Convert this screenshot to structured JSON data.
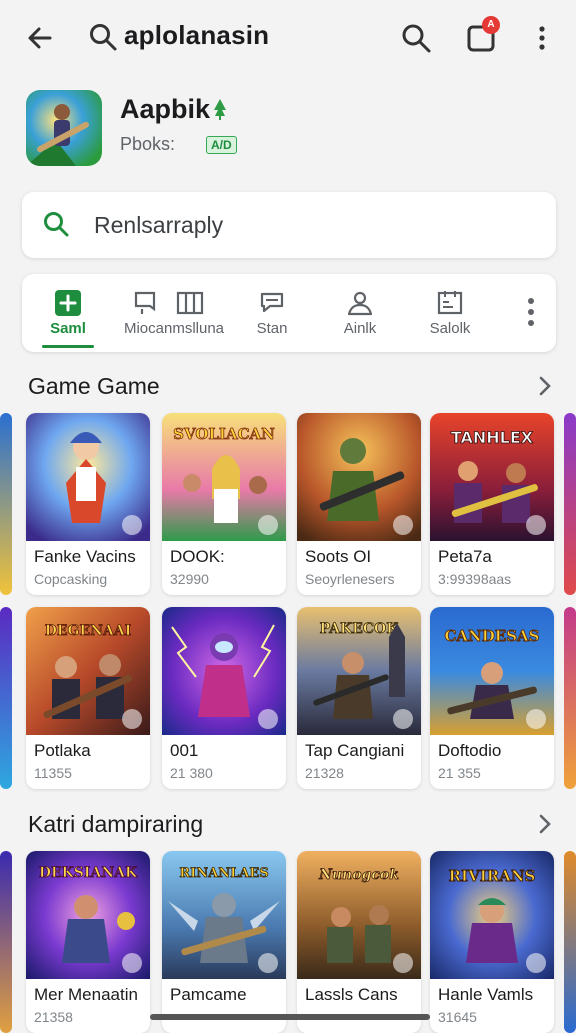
{
  "topbar": {
    "query": "aplolanasin",
    "badge": "A"
  },
  "app": {
    "name": "Aapbik",
    "publisher": "Pboks:",
    "ad_tag": "A/D"
  },
  "search": {
    "placeholder": "Renlsarraply"
  },
  "tabs": [
    {
      "label": "Saml",
      "icon": "plus-icon"
    },
    {
      "label": "Miocanmslluna",
      "icon": "book-columns-icon"
    },
    {
      "label": "Stan",
      "icon": "chat-icon"
    },
    {
      "label": "Ainlk",
      "icon": "person-icon"
    },
    {
      "label": "Salolk",
      "icon": "calendar-icon"
    }
  ],
  "sections": [
    {
      "title": "Game Game",
      "rows": [
        [
          {
            "name": "Fanke Vacins",
            "meta": "Copcasking",
            "art": "ART1"
          },
          {
            "name": "DOOK:",
            "meta": "32990",
            "art": "ART2"
          },
          {
            "name": "Soots OI",
            "meta": "Seoyrlenesers",
            "art": "ART3"
          },
          {
            "name": "Peta7a",
            "meta": "3:99398aas",
            "art": "ART4"
          }
        ],
        [
          {
            "name": "Potlaka",
            "meta": "11355",
            "art": "ART5"
          },
          {
            "name": "001",
            "meta": "21 380",
            "art": "ART6"
          },
          {
            "name": "Tap Cangiani",
            "meta": "21328",
            "art": "ART7"
          },
          {
            "name": "Doftodio",
            "meta": "21 355",
            "art": "ART8"
          }
        ]
      ]
    },
    {
      "title": "Katri dampiraring",
      "rows": [
        [
          {
            "name": "Mer Menaatin",
            "meta": "21358",
            "art": "ART9"
          },
          {
            "name": "Pamcame",
            "meta": "",
            "art": "ART10"
          },
          {
            "name": "Lassls Cans",
            "meta": "",
            "art": "ART11"
          },
          {
            "name": "Hanle Vamls",
            "meta": "31645",
            "art": "ART12"
          }
        ]
      ]
    }
  ],
  "art_text": {
    "ART1": "",
    "ART2": "SVOLIACAN",
    "ART3": "",
    "ART4": "TANHLEX",
    "ART5": "DEGENAAI",
    "ART6": "",
    "ART7": "PAKECOK",
    "ART8": "CANDESAS",
    "ART9": "DEKSIANAK",
    "ART10": "RINANLAES",
    "ART11": "Nunogcok",
    "ART12": "RIVIRANS"
  },
  "colors": {
    "accent_green": "#1e8e3e",
    "badge_red": "#e53935",
    "background": "#f3f3f4"
  }
}
